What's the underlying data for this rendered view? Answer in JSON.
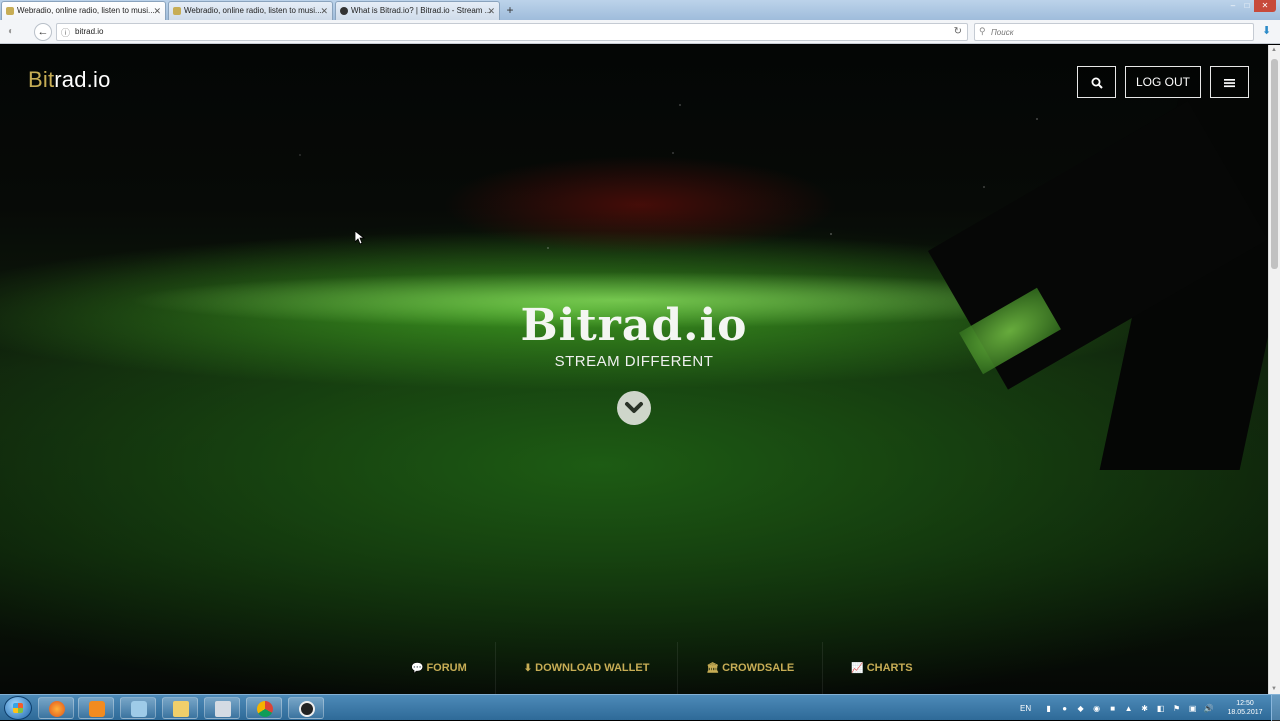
{
  "browser": {
    "tabs": [
      {
        "title": "Webradio, online radio, listen to musi...",
        "active": true
      },
      {
        "title": "Webradio, online radio, listen to musi...",
        "active": false
      },
      {
        "title": "What is Bitrad.io? | Bitrad.io - Stream ...",
        "active": false
      }
    ],
    "new_tab_label": "+",
    "url": "bitrad.io",
    "search_placeholder": "Поиск"
  },
  "site": {
    "brand_accent": "Bit",
    "brand_rest": "rad.io",
    "logout_label": "LOG OUT",
    "hero_title": "Bitrad.io",
    "hero_subtitle": "STREAM DIFFERENT",
    "bottom_nav": [
      {
        "icon": "comments-icon",
        "label": "FORUM"
      },
      {
        "icon": "download-icon",
        "label": "DOWNLOAD WALLET"
      },
      {
        "icon": "bank-icon",
        "label": "CROWDSALE"
      },
      {
        "icon": "chart-icon",
        "label": "CHARTS"
      }
    ],
    "colors": {
      "accent": "#c7ad55",
      "background": "#0b1a09"
    }
  },
  "taskbar": {
    "language": "EN",
    "time": "12:50",
    "date": "18.05.2017"
  }
}
